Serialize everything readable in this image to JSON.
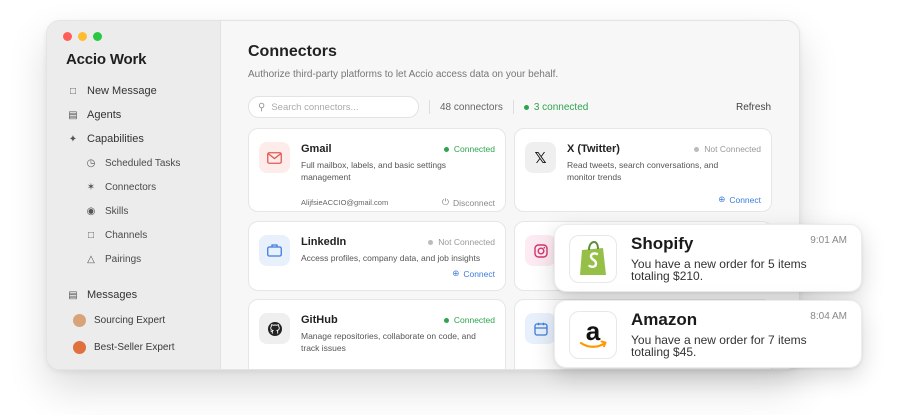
{
  "app": {
    "name": "Accio Work"
  },
  "window_controls": {
    "colors": [
      "#ff5f57",
      "#febc2e",
      "#28c840"
    ]
  },
  "sidebar": {
    "items": [
      {
        "label": "New Message",
        "icon": "message-square-icon"
      },
      {
        "label": "Agents",
        "icon": "agents-icon"
      },
      {
        "label": "Capabilities",
        "icon": "capabilities-icon"
      }
    ],
    "capabilities": [
      {
        "label": "Scheduled Tasks",
        "icon": "clock-icon"
      },
      {
        "label": "Connectors",
        "icon": "connector-icon"
      },
      {
        "label": "Skills",
        "icon": "skills-icon"
      },
      {
        "label": "Channels",
        "icon": "channels-icon"
      },
      {
        "label": "Pairings",
        "icon": "pairings-icon"
      }
    ],
    "messages_label": "Messages",
    "messages": [
      {
        "label": "Sourcing Expert",
        "avatar_color": "#d9a37a"
      },
      {
        "label": "Best-Seller Expert",
        "avatar_color": "#e0703e"
      }
    ]
  },
  "main": {
    "title": "Connectors",
    "subtitle": "Authorize third-party platforms to let Accio access data on your behalf.",
    "search_placeholder": "Search connectors...",
    "count_label": "48 connectors",
    "connected_label": "3 connected",
    "refresh_label": "Refresh"
  },
  "connectors": [
    {
      "name": "Gmail",
      "status": "Connected",
      "description": "Full mailbox, labels, and basic settings management",
      "email": "AlijfsieACCIO@gmail.com",
      "action": "Disconnect",
      "icon": "mail-icon",
      "icon_color": "#e05a4f",
      "icon_bg": "#fdecea"
    },
    {
      "name": "X (Twitter)",
      "status": "Not Connected",
      "description": "Read tweets, search conversations, and monitor trends",
      "action": "Connect",
      "icon": "x-logo-icon",
      "icon_color": "#111111",
      "icon_bg": "#efefef"
    },
    {
      "name": "LinkedIn",
      "status": "Not Connected",
      "description": "Access profiles, company data, and job insights",
      "action": "Connect",
      "icon": "briefcase-icon",
      "icon_color": "#3b7ddd",
      "icon_bg": "#e8f0fc"
    },
    {
      "name": "GitHub",
      "status": "Connected",
      "description": "Manage repositories, collaborate on code, and track issues",
      "icon": "github-icon",
      "icon_color": "#222222",
      "icon_bg": "#efefef"
    }
  ],
  "notifications": [
    {
      "title": "Shopify",
      "time": "9:01 AM",
      "text": "You have a new order for 5 items totaling $210.",
      "icon": "shopify-bag-icon",
      "color": "#95bf47"
    },
    {
      "title": "Amazon",
      "time": "8:04 AM",
      "text": "You have a new order for 7 items totaling $45.",
      "icon": "amazon-logo-icon",
      "color": "#ff9900"
    }
  ],
  "colors": {
    "connected": "#2ea44f",
    "not_connected": "#999999",
    "link": "#3b7ddd"
  }
}
